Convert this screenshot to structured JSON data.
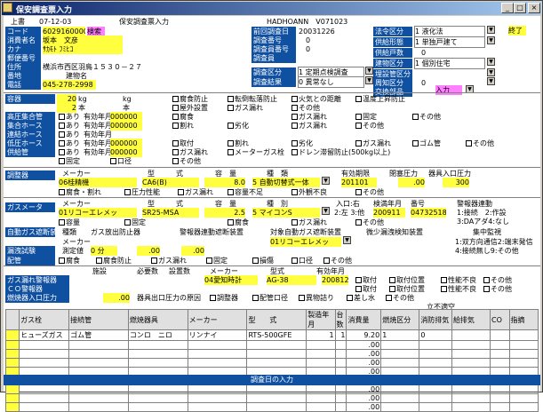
{
  "window": {
    "title": "保安調査票入力",
    "minimize": "_",
    "maximize": "□",
    "close": "×"
  },
  "header": {
    "left": "上書",
    "date": "07-12-03",
    "screen_name": "保安調査票入力",
    "right": "HADHOANN　V071023"
  },
  "customer": {
    "code_label": "コード",
    "code": "6029160000",
    "tag": "検索",
    "name_label": "消費者名",
    "name": "坂本　文彦",
    "kana_label": "カナ",
    "kana": "ｻｶﾓﾄ ﾌﾐﾋｺ",
    "zip_label": "郵便番号",
    "addr_label": "住所",
    "addr": "横浜市西区羽鳥１５３０－２７",
    "bldg_label": "番地",
    "bldg": "建物名",
    "tel_label": "電話",
    "tel": "045-278-2998"
  },
  "survey": {
    "prev_label": "前回調査日",
    "prev": "20031226",
    "no_label": "調査番号",
    "no": "0",
    "person_no_label": "調査員番号",
    "person_no": "0",
    "person_label": "調査員",
    "date_label": "調査区分",
    "date": "1 定期点検調査",
    "result_label": "調査結果",
    "result": "0 異常なし"
  },
  "law": {
    "law_label": "法令区分",
    "law": "1 液化法",
    "supply_label": "供給形態",
    "supply": "1 単独戸建て",
    "count_label": "供給戸数",
    "count": "0",
    "bldg_type_label": "建物区分",
    "bldg_type": "1 個別住宅",
    "bury_label": "埋設管区分",
    "cycle_label": "周知区分",
    "cycle": "0",
    "exchange_label": "交換部品",
    "end": "終了",
    "input": "入力"
  },
  "vessel": {
    "label": "容器",
    "kg1": "20",
    "kg2": "2",
    "unit1": "kg",
    "unit2": "本",
    "unit3": "kg",
    "unit4": "本",
    "checks": [
      "腐食防止",
      "転倒転落防止",
      "火気との距離",
      "温度上昇防止",
      "屋外設置",
      "ガス漏れ",
      "その他"
    ]
  },
  "rows": [
    {
      "label": "高圧集合管",
      "checks": [
        "あり",
        "有効年月",
        "000000",
        "腐食",
        "ガス漏れ",
        "固定",
        "その他"
      ]
    },
    {
      "label": "集合ホース",
      "checks": [
        "あり",
        "有効年月",
        "000000",
        "割れ",
        "劣化",
        "ガス漏れ",
        "その他"
      ]
    },
    {
      "label": "連結ホース",
      "checks": [
        "あり",
        "有効年月"
      ]
    },
    {
      "label": "低圧ホース",
      "checks": [
        "あり",
        "有効年月",
        "000000",
        "取付",
        "割れ",
        "劣化",
        "ガス漏れ",
        "ゴム管",
        "その他"
      ]
    },
    {
      "label": "供給管",
      "checks": [
        "あり",
        "有効年月",
        "000000",
        "ガス漏れ",
        "メーターガス栓",
        "ドレン滞留防止(500kg以上)",
        "固定",
        "口径",
        "その他"
      ]
    }
  ],
  "regulator": {
    "label": "調整器",
    "maker_h": "メーカー",
    "model_h": "型　　　式",
    "cap_h": "容　量",
    "kind_h": "種　類",
    "valid_h": "有効期限",
    "press_h": "閉塞圧力",
    "in_press_h": "器具入口圧力",
    "maker": "06桂精機",
    "model": "CA6(B)",
    "cap": "8.0",
    "kind": "5 自動切替式一体",
    "valid": "201101",
    "press": ".00",
    "in_press": "300",
    "checks": [
      "腐食・割れ",
      "圧力性能",
      "ガス漏れ",
      "容量不足",
      "外観不良",
      "その他"
    ]
  },
  "meter": {
    "label": "ガスメータ",
    "maker_h": "メーカー",
    "model_h": "型　　　式",
    "cap_h": "容　量",
    "kind_h": "種　別",
    "lr_h": "入口:右",
    "valid_h": "検満年月",
    "no_h": "番号",
    "alarm_h": "警報器連動",
    "maker": "01リコーエレメッ",
    "model": "SR25-MSA",
    "cap": "2.5",
    "kind": "5 マイコンS",
    "lr": "2:左 3:他",
    "valid": "200911",
    "no": "04732518",
    "alarm": "1:接続　2:作設",
    "alarm2": "3:DAアダ4:なし",
    "checks": [
      "容量",
      "固定",
      "腐食",
      "ガス漏れ",
      "その他"
    ]
  },
  "auto": {
    "label": "自動ガス遮断装置",
    "kind_h": "種類",
    "std_h": "ガス放出防止器",
    "alarm_h": "警報器連動遮断装置",
    "target_h": "対象自動ガス遮断装置",
    "micro_h": "微少漏洩検知装置",
    "watch_h": "集中監視",
    "maker_h": "メーカー",
    "maker": "01リコーエレメッ",
    "test_label": "漏洩試験",
    "test": "測定値",
    "min": "0 分",
    "v1": ".00",
    "v2": ".00",
    "watch1": "1:双方向通信2:端末発信",
    "watch2": "4:接続無し9:その他"
  },
  "piping": {
    "label": "配管",
    "checks": [
      "腐食",
      "腐食防止",
      "ガス漏れ",
      "固定",
      "損傷",
      "口径",
      "その他"
    ]
  },
  "alarm_rows": [
    {
      "label": "ガス漏れ警報器",
      "h1": "施設",
      "h2": "必要数",
      "h3": "設置数",
      "maker_h": "メーカー",
      "model_h": "型式",
      "valid_h": "有効年月",
      "maker": "04愛知時計",
      "model": "AG-38",
      "valid": "200812",
      "checks": [
        "取付",
        "取付位置",
        "性能不良",
        "その他"
      ]
    },
    {
      "label": "ＣＯ警報器",
      "checks": [
        "取付",
        "取付位置",
        "性能不良",
        "その他"
      ]
    },
    {
      "label": "燃焼器入口圧力",
      "val": ".00",
      "cause": "器具出口圧力の原因",
      "checks": [
        "調整器",
        "配管口径",
        "異物詰り",
        "差し水",
        "その他"
      ]
    }
  ],
  "appl_table": {
    "headers": [
      "ガス栓",
      "接続管",
      "燃焼器具",
      "メーカー",
      "型　　式",
      "製造年月",
      "台数",
      "消費量",
      "燃焼区分",
      "消防排気",
      "給排気",
      "CO",
      "指摘"
    ],
    "vent_h": "立不適空",
    "rows": [
      {
        "c1": "ヒューズガス",
        "c2": "ゴム管",
        "c3": "コンロ　ニロ",
        "c4": "リンナイ",
        "c5": "RTS-500GFE",
        "c6": "1",
        "c7": "1",
        "c8": "9.20",
        "c9": "1",
        "c10": "0"
      },
      {
        "c8": ".00"
      },
      {
        "c8": ".00"
      },
      {
        "c8": ".00"
      },
      {
        "c8": ".00"
      },
      {
        "c8": ".00"
      },
      {
        "c8": ".00"
      },
      {
        "c8": ".00"
      },
      {
        "c8": ".00"
      }
    ]
  },
  "status": "調査日の入力"
}
